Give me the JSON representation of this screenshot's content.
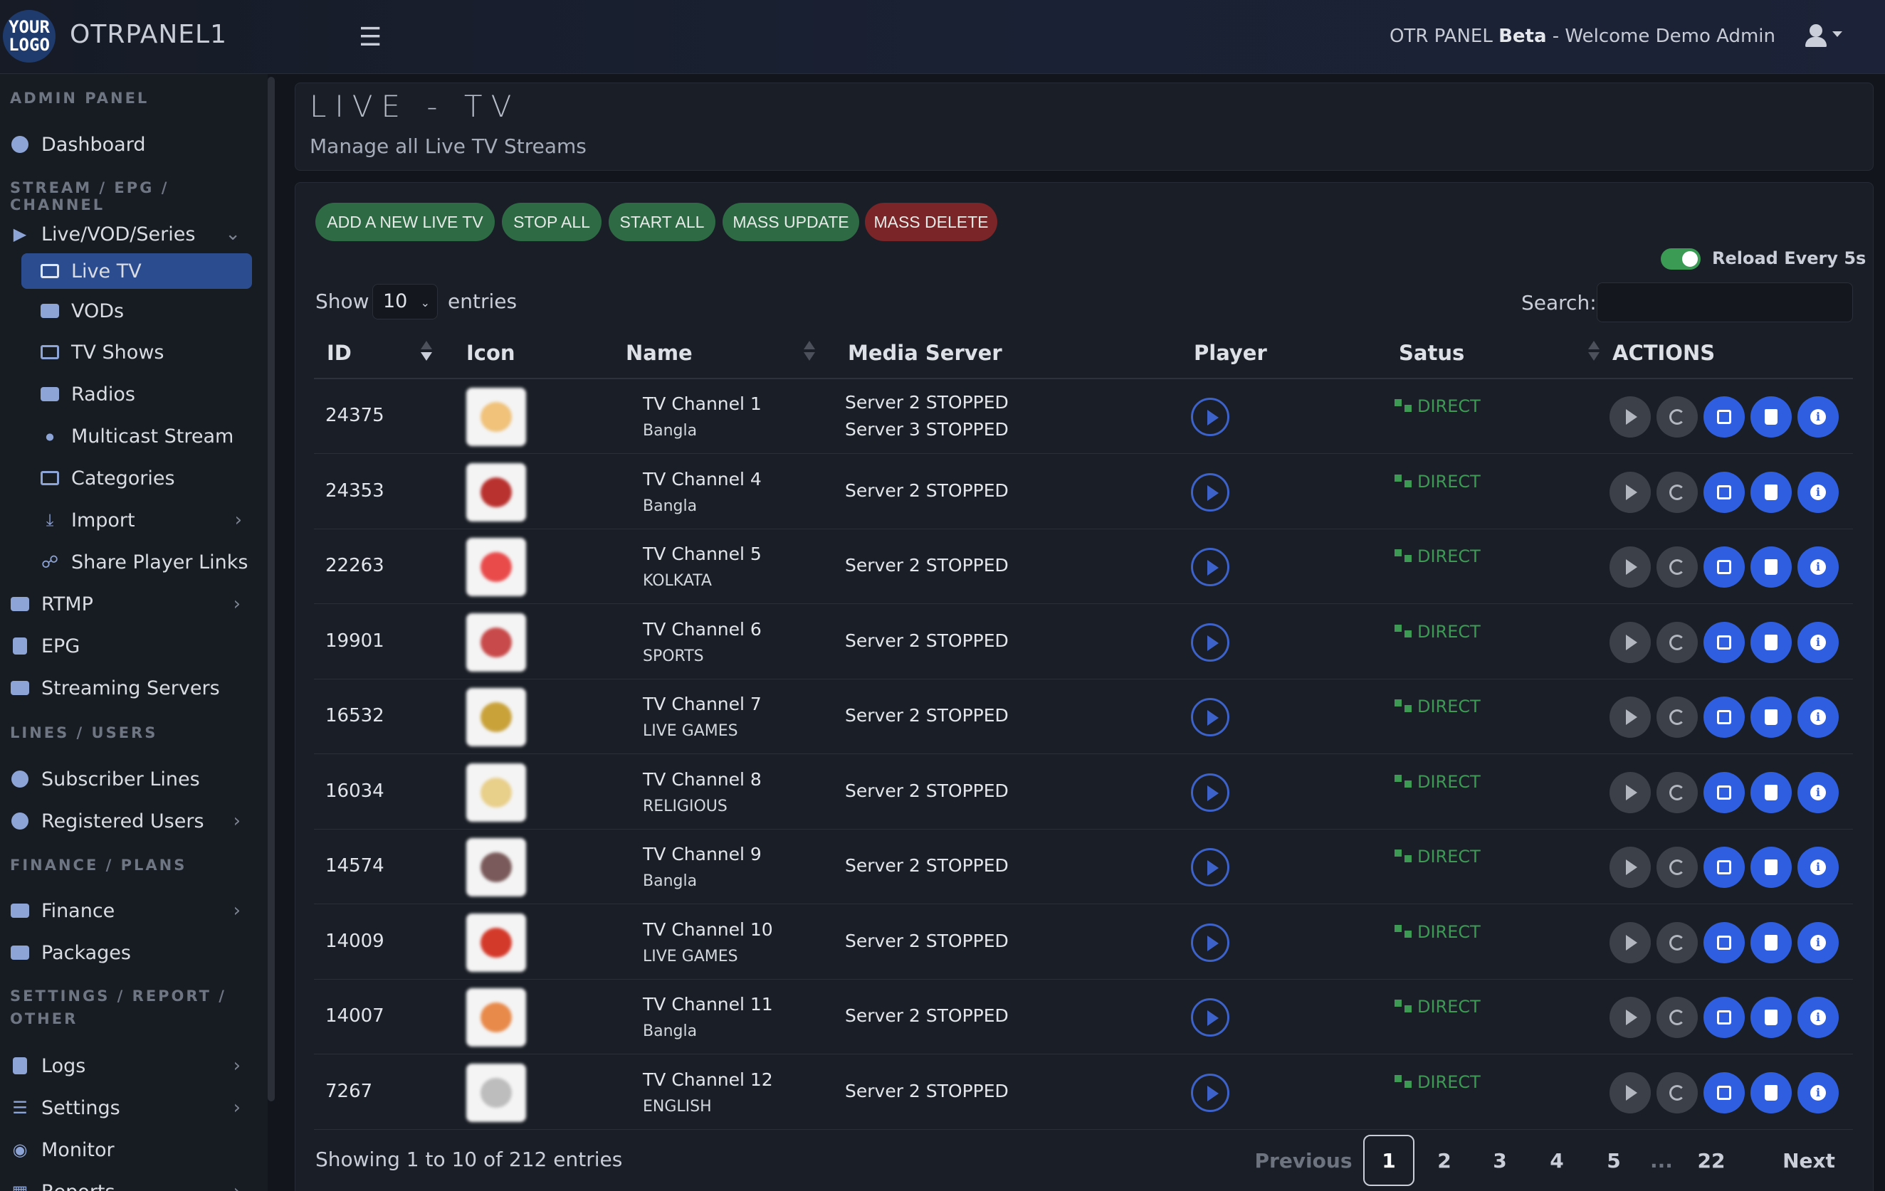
{
  "header": {
    "logo_line1": "YOUR",
    "logo_line2": "LOGO",
    "app_name": "OTRPANEL1",
    "welcome_prefix": "OTR PANEL ",
    "welcome_beta": "Beta",
    "welcome_suffix": " - Welcome Demo Admin"
  },
  "sidebar": {
    "section_admin": "ADMIN PANEL",
    "dashboard": "Dashboard",
    "section_stream": "STREAM / EPG / CHANNEL",
    "live_vod_series": "Live/VOD/Series",
    "live_tv": "Live TV",
    "vods": "VODs",
    "tv_shows": "TV Shows",
    "radios": "Radios",
    "multicast": "Multicast Stream",
    "categories": "Categories",
    "import": "Import",
    "share_player": "Share Player Links",
    "rtmp": "RTMP",
    "epg": "EPG",
    "streaming_servers": "Streaming Servers",
    "section_lines": "LINES / USERS",
    "subscriber_lines": "Subscriber Lines",
    "registered_users": "Registered Users",
    "section_finance": "FINANCE / PLANS",
    "finance": "Finance",
    "packages": "Packages",
    "section_settings_1": "SETTINGS / REPORT /",
    "section_settings_2": "OTHER",
    "logs": "Logs",
    "settings": "Settings",
    "monitor": "Monitor",
    "reports": "Reports"
  },
  "page": {
    "title": "LIVE - TV",
    "subtitle": "Manage all Live TV Streams"
  },
  "toolbar": {
    "add": "ADD A NEW LIVE TV",
    "stop_all": "STOP ALL",
    "start_all": "START ALL",
    "mass_update": "MASS UPDATE",
    "mass_delete": "MASS DELETE",
    "reload": "Reload Every 5s",
    "reload_on": true
  },
  "table_controls": {
    "show": "Show",
    "page_size": "10",
    "entries": "entries",
    "search": "Search:",
    "search_value": ""
  },
  "columns": {
    "id": "ID",
    "icon": "Icon",
    "name": "Name",
    "media_server": "Media Server",
    "player": "Player",
    "status": "Satus",
    "actions": "ACTIONS"
  },
  "rows": [
    {
      "id": "24375",
      "name": "TV Channel 1",
      "category": "Bangla",
      "server1": "Server 2 STOPPED",
      "server2": "Server 3 STOPPED",
      "status": "DIRECT",
      "thumb_color": "#f0c27a"
    },
    {
      "id": "24353",
      "name": "TV Channel 4",
      "category": "Bangla",
      "server1": "Server 2 STOPPED",
      "server2": "",
      "status": "DIRECT",
      "thumb_color": "#b9322f"
    },
    {
      "id": "22263",
      "name": "TV Channel 5",
      "category": "KOLKATA",
      "server1": "Server 2 STOPPED",
      "server2": "",
      "status": "DIRECT",
      "thumb_color": "#e94b4b"
    },
    {
      "id": "19901",
      "name": "TV Channel 6",
      "category": "SPORTS",
      "server1": "Server 2 STOPPED",
      "server2": "",
      "status": "DIRECT",
      "thumb_color": "#c84a4a"
    },
    {
      "id": "16532",
      "name": "TV Channel 7",
      "category": "LIVE GAMES",
      "server1": "Server 2 STOPPED",
      "server2": "",
      "status": "DIRECT",
      "thumb_color": "#c9a23a"
    },
    {
      "id": "16034",
      "name": "TV Channel 8",
      "category": "RELIGIOUS",
      "server1": "Server 2 STOPPED",
      "server2": "",
      "status": "DIRECT",
      "thumb_color": "#e8cf8a"
    },
    {
      "id": "14574",
      "name": "TV Channel 9",
      "category": "Bangla",
      "server1": "Server 2 STOPPED",
      "server2": "",
      "status": "DIRECT",
      "thumb_color": "#7a5a5a"
    },
    {
      "id": "14009",
      "name": "TV Channel 10",
      "category": "LIVE GAMES",
      "server1": "Server 2 STOPPED",
      "server2": "",
      "status": "DIRECT",
      "thumb_color": "#d43a2a"
    },
    {
      "id": "14007",
      "name": "TV Channel 11",
      "category": "Bangla",
      "server1": "Server 2 STOPPED",
      "server2": "",
      "status": "DIRECT",
      "thumb_color": "#e88a4a"
    },
    {
      "id": "7267",
      "name": "TV Channel 12",
      "category": "ENGLISH",
      "server1": "Server 2 STOPPED",
      "server2": "",
      "status": "DIRECT",
      "thumb_color": "#bdbdbd"
    }
  ],
  "footer": {
    "showing": "Showing 1 to 10 of 212 entries",
    "previous": "Previous",
    "pages": [
      "1",
      "2",
      "3",
      "4",
      "5",
      "...",
      "22"
    ],
    "current_page": "1",
    "next": "Next"
  },
  "colors": {
    "accent_blue": "#2f5fe0",
    "active_nav": "#2b4c8f",
    "direct_green": "#3d9a55",
    "button_green": "#2e6b45",
    "button_red": "#7a2528"
  }
}
